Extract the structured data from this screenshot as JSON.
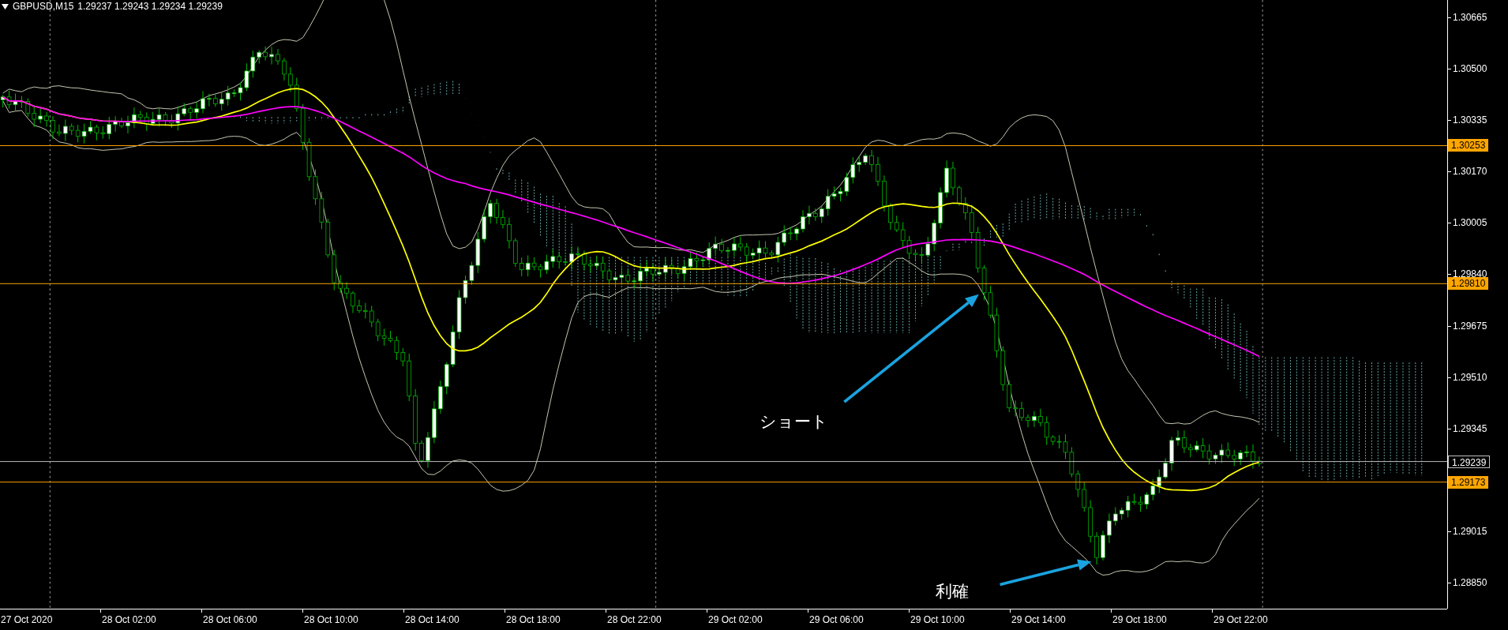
{
  "chart_header": {
    "symbol": "GBPUSD,M15",
    "quote": "1.29237 1.29243 1.29234 1.29239"
  },
  "price_axis": {
    "labels": [
      "1.30665",
      "1.30500",
      "1.30335",
      "1.30170",
      "1.30005",
      "1.29840",
      "1.29675",
      "1.29510",
      "1.29345",
      "1.29015",
      "1.28850"
    ]
  },
  "price_lines": [
    {
      "kind": "level",
      "price": "1.30253",
      "color": "#ffa500"
    },
    {
      "kind": "level",
      "price": "1.29810",
      "color": "#ffa500"
    },
    {
      "kind": "bid",
      "price": "1.29239",
      "color": "#c0c0c0"
    },
    {
      "kind": "level",
      "price": "1.29173",
      "color": "#ffa500"
    }
  ],
  "time_axis": {
    "labels": [
      "27 Oct 2020",
      "28 Oct 02:00",
      "28 Oct 06:00",
      "28 Oct 10:00",
      "28 Oct 14:00",
      "28 Oct 18:00",
      "28 Oct 22:00",
      "29 Oct 02:00",
      "29 Oct 06:00",
      "29 Oct 10:00",
      "29 Oct 14:00",
      "29 Oct 18:00",
      "29 Oct 22:00"
    ]
  },
  "annotations": [
    {
      "text": "ショート"
    },
    {
      "text": "利確"
    }
  ]
}
